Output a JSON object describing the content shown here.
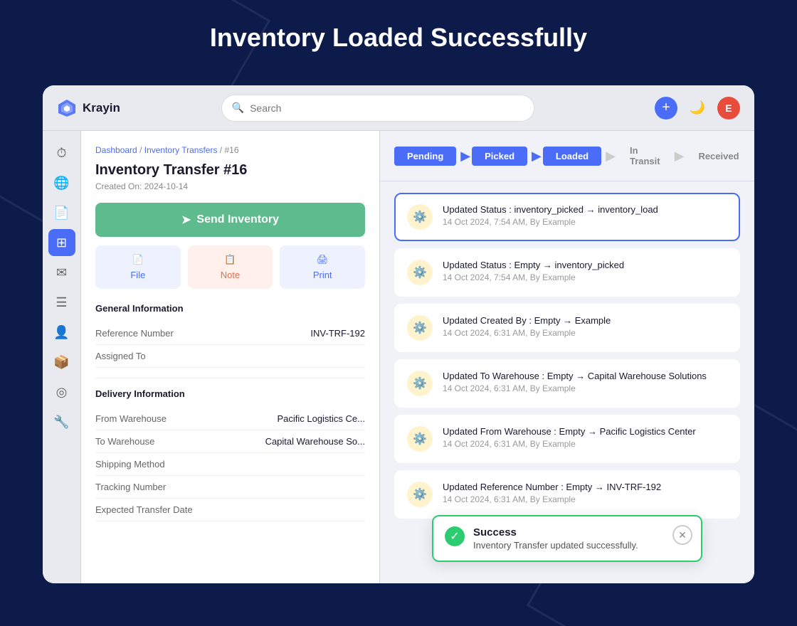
{
  "page": {
    "title": "Inventory Loaded Successfully"
  },
  "header": {
    "logo_text": "Krayin",
    "search_placeholder": "Search",
    "add_button_label": "+",
    "avatar_initials": "E"
  },
  "breadcrumb": {
    "dashboard": "Dashboard",
    "separator1": " / ",
    "transfers": "Inventory Transfers",
    "separator2": " / ",
    "id": "#16"
  },
  "transfer": {
    "title": "Inventory Transfer #16",
    "created_label": "Created On:",
    "created_date": "2024-10-14"
  },
  "buttons": {
    "send_inventory": "Send Inventory",
    "file": "File",
    "note": "Note",
    "print": "Print"
  },
  "general_info": {
    "section_title": "General Information",
    "ref_label": "Reference Number",
    "ref_value": "INV-TRF-192",
    "assigned_label": "Assigned To",
    "assigned_value": ""
  },
  "delivery_info": {
    "section_title": "Delivery Information",
    "from_label": "From Warehouse",
    "from_value": "Pacific Logistics Ce...",
    "to_label": "To Warehouse",
    "to_value": "Capital Warehouse So...",
    "shipping_label": "Shipping Method",
    "shipping_value": "",
    "tracking_label": "Tracking Number",
    "tracking_value": "",
    "expected_label": "Expected Transfer Date",
    "expected_value": ""
  },
  "status_tabs": [
    {
      "label": "Pending",
      "state": "done"
    },
    {
      "label": "Picked",
      "state": "done"
    },
    {
      "label": "Loaded",
      "state": "active"
    },
    {
      "label": "In Transit",
      "state": "inactive"
    },
    {
      "label": "Received",
      "state": "inactive"
    }
  ],
  "activity": [
    {
      "id": 1,
      "highlighted": true,
      "title": "Updated Status : inventory_picked → inventory_load",
      "time": "14 Oct 2024, 7:54 AM, By Example"
    },
    {
      "id": 2,
      "highlighted": false,
      "title": "Updated Status : Empty → inventory_picked",
      "time": "14 Oct 2024, 7:54 AM, By Example"
    },
    {
      "id": 3,
      "highlighted": false,
      "title": "Updated Created By : Empty → Example",
      "time": "14 Oct 2024, 6:31 AM, By Example"
    },
    {
      "id": 4,
      "highlighted": false,
      "title": "Updated To Warehouse : Empty → Capital Warehouse Solutions",
      "time": "14 Oct 2024, 6:31 AM, By Example"
    },
    {
      "id": 5,
      "highlighted": false,
      "title": "Updated From Warehouse : Empty → Pacific Logistics Center",
      "time": "14 Oct 2024, 6:31 AM, By Example"
    },
    {
      "id": 6,
      "highlighted": false,
      "title": "Updated Reference Number : Empty → INV-TRF-192",
      "time": "14 Oct 2024, 6:31 AM, By Example"
    }
  ],
  "toast": {
    "title": "Success",
    "message": "Inventory Transfer updated successfully.",
    "close_label": "✕"
  },
  "sidebar_icons": [
    {
      "name": "clock-icon",
      "symbol": "⏱",
      "active": false
    },
    {
      "name": "globe-icon",
      "symbol": "🌐",
      "active": false
    },
    {
      "name": "document-icon",
      "symbol": "📄",
      "active": false
    },
    {
      "name": "grid-icon",
      "symbol": "⊞",
      "active": true
    },
    {
      "name": "mail-icon",
      "symbol": "✉",
      "active": false
    },
    {
      "name": "list-icon",
      "symbol": "☰",
      "active": false
    },
    {
      "name": "user-icon",
      "symbol": "👤",
      "active": false
    },
    {
      "name": "package-icon",
      "symbol": "📦",
      "active": false
    },
    {
      "name": "location-icon",
      "symbol": "◎",
      "active": false
    },
    {
      "name": "wrench-icon",
      "symbol": "🔧",
      "active": false
    }
  ]
}
